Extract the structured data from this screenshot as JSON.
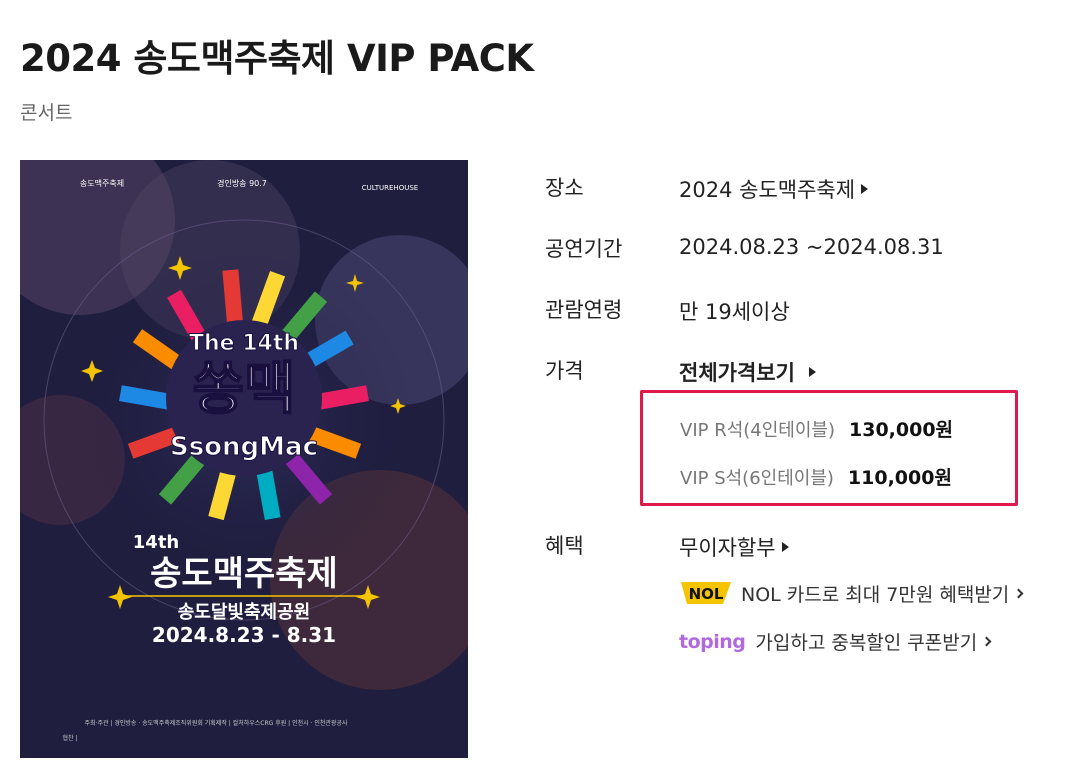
{
  "header": {
    "title": "2024 송도맥주축제 VIP PACK",
    "category": "콘서트"
  },
  "poster": {
    "sponsor_left": "송도맥주축제",
    "sponsor_mid": "경인방송 90.7",
    "sponsor_right": "CULTUREHOUSE",
    "badge_top": "The 14th",
    "badge_main": "쏭맥",
    "badge_sub": "SsongMac",
    "edition": "14th",
    "festival_name": "송도맥주축제",
    "venue": "송도달빛축제공원",
    "dates": "2024.8.23 - 8.31",
    "credits_line1": "주최·주관 | 경인방송 · 송도맥주축제조직위원회   기획제작 | 컬처하우스CRG   후원 | 인천시 · 인천관광공사",
    "credits_line2": "협찬 |"
  },
  "info": {
    "venue_label": "장소",
    "venue_value": "2024 송도맥주축제",
    "period_label": "공연기간",
    "period_value": "2024.08.23 ~2024.08.31",
    "age_label": "관람연령",
    "age_value": "만 19세이상",
    "price_label": "가격",
    "price_all_link": "전체가격보기",
    "prices": [
      {
        "seat": "VIP R석(4인테이블)",
        "amount": "130,000원"
      },
      {
        "seat": "VIP S석(6인테이블)",
        "amount": "110,000원"
      }
    ],
    "benefit_label": "혜택",
    "benefit_value": "무이자할부",
    "nol_logo_text": "NOL",
    "nol_benefit": "NOL 카드로 최대 7만원 혜택받기",
    "toping_logo_text": "toping",
    "toping_benefit": "가입하고 중복할인 쿠폰받기"
  },
  "colors": {
    "highlight_border": "#e0194a",
    "poster_bg": "#1f1e3f",
    "toping": "#b06ae0",
    "nol_yellow": "#f5c400"
  }
}
